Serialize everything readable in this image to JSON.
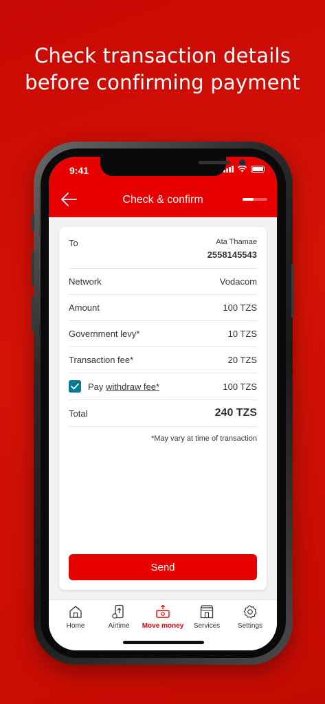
{
  "headline": {
    "line1": "Check transaction details",
    "line2": "before confirming payment"
  },
  "status_bar": {
    "time": "9:41",
    "icons": [
      "signal-icon",
      "wifi-icon",
      "battery-icon"
    ]
  },
  "header": {
    "title": "Check & confirm",
    "back_icon": "back-arrow-icon",
    "color": "#e60000"
  },
  "details": {
    "to_label": "To",
    "to_name": "Ata Thamae",
    "to_number": "2558145543",
    "network_label": "Network",
    "network_value": "Vodacom",
    "amount_label": "Amount",
    "amount_value": "100 TZS",
    "levy_label": "Government levy*",
    "levy_value": "10 TZS",
    "fee_label": "Transaction fee*",
    "fee_value": "20 TZS",
    "withdraw_prefix": "Pay ",
    "withdraw_link": "withdraw fee*",
    "withdraw_value": "100 TZS",
    "withdraw_checked": true,
    "total_label": "Total",
    "total_value": "240 TZS",
    "note": "*May vary at time of transaction"
  },
  "send_button": {
    "label": "Send"
  },
  "tabbar": {
    "items": [
      {
        "label": "Home",
        "icon": "home-icon",
        "active": false
      },
      {
        "label": "Airtime",
        "icon": "airtime-icon",
        "active": false
      },
      {
        "label": "Move money",
        "icon": "move-money-icon",
        "active": true
      },
      {
        "label": "Services",
        "icon": "services-icon",
        "active": false
      },
      {
        "label": "Settings",
        "icon": "settings-icon",
        "active": false
      }
    ]
  },
  "colors": {
    "brand_red": "#e60000",
    "checkbox_teal": "#007c92",
    "background_red": "#d51206"
  }
}
